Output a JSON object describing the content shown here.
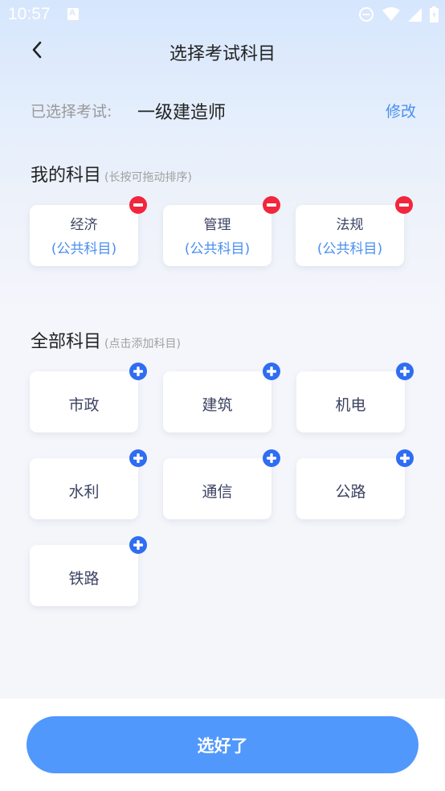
{
  "status_bar": {
    "time": "10:57",
    "left_icons": [
      "a-notification-icon"
    ],
    "right_icons": [
      "do-not-disturb-icon",
      "wifi-icon",
      "cellular-signal-icon",
      "battery-charging-icon"
    ]
  },
  "nav": {
    "back_icon": "chevron-left-icon",
    "title": "选择考试科目"
  },
  "selected_exam": {
    "label": "已选择考试:",
    "value": "一级建造师",
    "modify_label": "修改"
  },
  "my_subjects": {
    "title": "我的科目",
    "hint": "(长按可拖动排序)",
    "items": [
      {
        "name": "经济",
        "sub": "(公共科目)",
        "badge_icon": "remove-icon"
      },
      {
        "name": "管理",
        "sub": "(公共科目)",
        "badge_icon": "remove-icon"
      },
      {
        "name": "法规",
        "sub": "(公共科目)",
        "badge_icon": "remove-icon"
      }
    ]
  },
  "all_subjects": {
    "title": "全部科目",
    "hint": "(点击添加科目)",
    "items": [
      {
        "name": "市政",
        "badge_icon": "add-icon"
      },
      {
        "name": "建筑",
        "badge_icon": "add-icon"
      },
      {
        "name": "机电",
        "badge_icon": "add-icon"
      },
      {
        "name": "水利",
        "badge_icon": "add-icon"
      },
      {
        "name": "通信",
        "badge_icon": "add-icon"
      },
      {
        "name": "公路",
        "badge_icon": "add-icon"
      },
      {
        "name": "铁路",
        "badge_icon": "add-icon"
      }
    ]
  },
  "confirm_button": {
    "label": "选好了"
  },
  "colors": {
    "accent_blue": "#5198fd",
    "link_blue": "#4a8fef",
    "remove_red": "#f2263c",
    "add_blue": "#2f6df2",
    "text_dark": "#222222",
    "text_gray": "#999999"
  }
}
